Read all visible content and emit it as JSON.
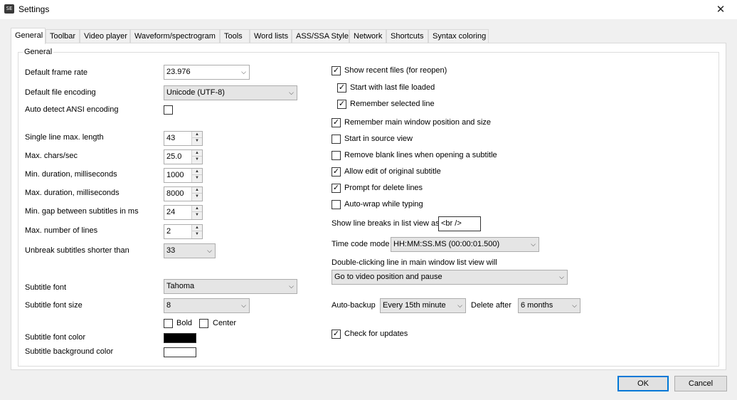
{
  "window": {
    "title": "Settings",
    "icon": "SE",
    "close_glyph": "✕"
  },
  "tabs": [
    "General",
    "Toolbar",
    "Video player",
    "Waveform/spectrogram",
    "Tools",
    "Word lists",
    "ASS/SSA Style",
    "Network",
    "Shortcuts",
    "Syntax coloring"
  ],
  "group_title": "General",
  "left": {
    "default_frame_rate": {
      "label": "Default frame rate",
      "value": "23.976"
    },
    "default_file_encoding": {
      "label": "Default file encoding",
      "value": "Unicode (UTF-8)"
    },
    "auto_detect_ansi": {
      "label": "Auto detect ANSI encoding",
      "checked": false
    },
    "single_line_max_length": {
      "label": "Single line max. length",
      "value": "43"
    },
    "max_chars_sec": {
      "label": "Max. chars/sec",
      "value": "25.0"
    },
    "min_duration": {
      "label": "Min. duration, milliseconds",
      "value": "1000"
    },
    "max_duration": {
      "label": "Max. duration, milliseconds",
      "value": "8000"
    },
    "min_gap": {
      "label": "Min. gap between subtitles in ms",
      "value": "24"
    },
    "max_lines": {
      "label": "Max. number of lines",
      "value": "2"
    },
    "unbreak_shorter": {
      "label": "Unbreak subtitles shorter than",
      "value": "33"
    },
    "subtitle_font": {
      "label": "Subtitle font",
      "value": "Tahoma"
    },
    "subtitle_font_size": {
      "label": "Subtitle font size",
      "value": "8"
    },
    "bold": {
      "label": "Bold",
      "checked": false
    },
    "center": {
      "label": "Center",
      "checked": false
    },
    "font_color": {
      "label": "Subtitle font color",
      "color": "#000000"
    },
    "background_color": {
      "label": "Subtitle background color",
      "color": "#ffffff"
    }
  },
  "right": {
    "show_recent_files": {
      "label": "Show recent files (for reopen)",
      "checked": true
    },
    "start_with_last_file": {
      "label": "Start with last file loaded",
      "checked": true
    },
    "remember_selected_line": {
      "label": "Remember selected line",
      "checked": true
    },
    "remember_window": {
      "label": "Remember main window position and size",
      "checked": true
    },
    "start_in_source_view": {
      "label": "Start in source view",
      "checked": false
    },
    "remove_blank_lines": {
      "label": "Remove blank lines when opening a subtitle",
      "checked": false
    },
    "allow_edit_original": {
      "label": "Allow edit of original subtitle",
      "checked": true
    },
    "prompt_delete_lines": {
      "label": "Prompt for delete lines",
      "checked": true
    },
    "auto_wrap": {
      "label": "Auto-wrap while typing",
      "checked": false
    },
    "line_breaks": {
      "label": "Show line breaks in list view as",
      "value": "<br />"
    },
    "time_code_mode": {
      "label": "Time code mode",
      "value": "HH:MM:SS.MS (00:00:01.500)"
    },
    "double_click": {
      "label": "Double-clicking line in main window list view will",
      "value": "Go to video position and pause"
    },
    "auto_backup": {
      "label": "Auto-backup",
      "value": "Every 15th minute"
    },
    "delete_after": {
      "label": "Delete after",
      "value": "6 months"
    },
    "check_updates": {
      "label": "Check for updates",
      "checked": true
    }
  },
  "buttons": {
    "ok": "OK",
    "cancel": "Cancel"
  },
  "glyphs": {
    "check": "✓",
    "dropdown": "⌵",
    "spin_up": "▲",
    "spin_down": "▼"
  },
  "colors": {
    "accent": "#0078d7",
    "panel_bg": "#ffffff",
    "window_bg": "#f0f0f0"
  }
}
